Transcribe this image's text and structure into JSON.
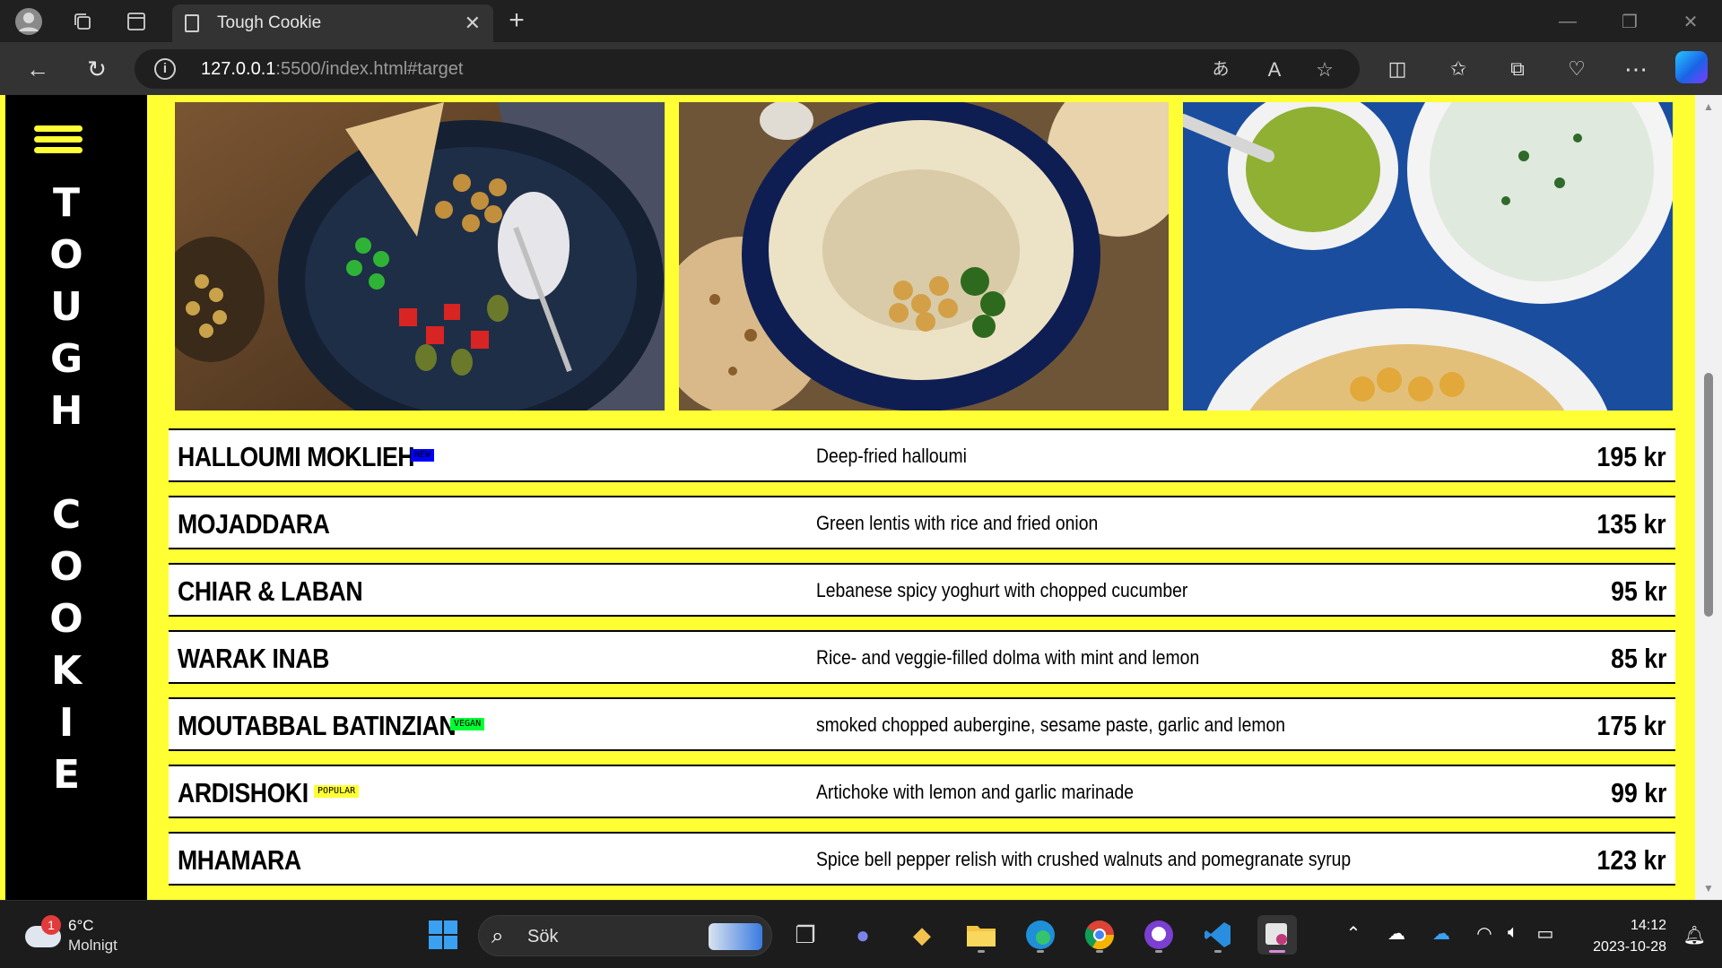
{
  "browser": {
    "tab_title": "Tough Cookie",
    "url_host": "127.0.0.1",
    "url_path": ":5500/index.html#target"
  },
  "brand": {
    "letters": [
      "T",
      "O",
      "U",
      "G",
      "H",
      "",
      "C",
      "O",
      "O",
      "K",
      "I",
      "E"
    ]
  },
  "gallery": [
    {
      "alt": "Salad bowl with chickpeas, olives and bread",
      "color": "#5a4028"
    },
    {
      "alt": "Hummus plate with chickpeas and pita",
      "color": "#6b5236"
    },
    {
      "alt": "Dips in white bowls on blue cloth",
      "color": "#1d4fa0"
    }
  ],
  "menu": [
    {
      "name": "HALLOUMI MOKLIEH",
      "badge": "NEW",
      "badge_color": "#0000ff",
      "description": "Deep-fried halloumi",
      "price": "195 kr"
    },
    {
      "name": "MOJADDARA",
      "badge": "",
      "badge_color": "",
      "description": "Green lentis with rice and fried onion",
      "price": "135 kr"
    },
    {
      "name": "CHIAR & LABAN",
      "badge": "",
      "badge_color": "",
      "description": "Lebanese spicy yoghurt with chopped cucumber",
      "price": "95 kr"
    },
    {
      "name": "WARAK INAB",
      "badge": "",
      "badge_color": "",
      "description": "Rice- and veggie-filled dolma with mint and lemon",
      "price": "85 kr"
    },
    {
      "name": "MOUTABBAL BATINZIAN",
      "badge": "VEGAN",
      "badge_color": "#00ff33",
      "description": "smoked chopped aubergine, sesame paste, garlic and lemon",
      "price": "175 kr"
    },
    {
      "name": "ARDISHOKI",
      "badge": "POPULAR",
      "badge_color": "#ffff33",
      "description": "Artichoke with lemon and garlic marinade",
      "price": "99 kr"
    },
    {
      "name": "MHAMARA",
      "badge": "",
      "badge_color": "",
      "description": "Spice bell pepper relish with crushed walnuts and pomegranate syrup",
      "price": "123 kr"
    }
  ],
  "taskbar": {
    "weather_badge": "1",
    "weather_temp": "6°C",
    "weather_cond": "Molnigt",
    "search_label": "Sök",
    "time": "14:12",
    "date": "2023-10-28"
  }
}
